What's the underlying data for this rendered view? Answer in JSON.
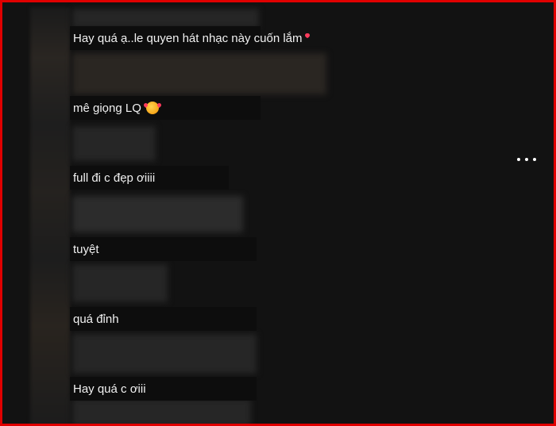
{
  "comments": [
    {
      "text": "Hay quá ạ..le quyen hát nhạc này cuốn lắm",
      "emoji": "smiling-face-with-hearts"
    },
    {
      "text": "mê giọng LQ",
      "emoji": "smiling-face-with-hearts"
    },
    {
      "text": "full đi c đẹp ơiiii"
    },
    {
      "text": "tuyệt"
    },
    {
      "text": "quá đỉnh"
    },
    {
      "text": "Hay quá c ơiii"
    }
  ],
  "icons": {
    "more_options": "more-options-icon"
  },
  "colors": {
    "border": "#e00000",
    "background": "#121212",
    "comment_bg": "#0d0d0d",
    "text": "#f1f1f1"
  }
}
